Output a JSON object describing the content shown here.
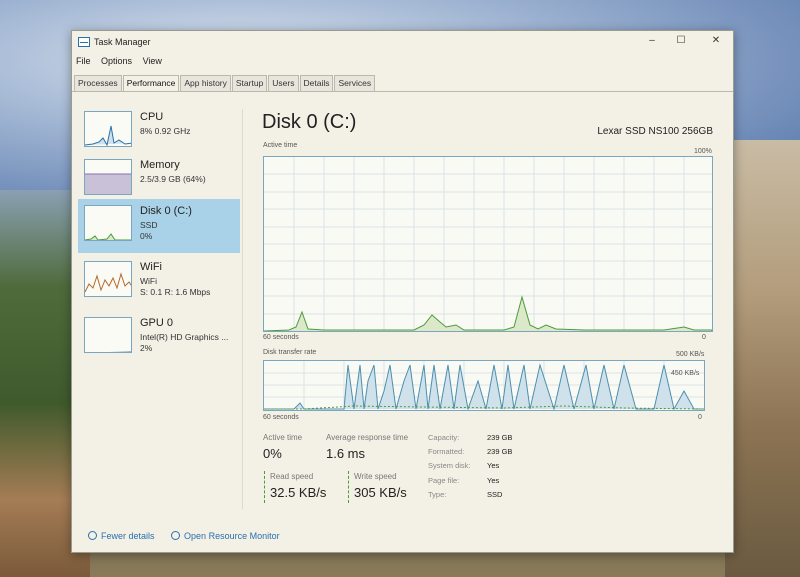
{
  "window": {
    "title": "Task Manager",
    "minimize": "–",
    "maximize": "☐",
    "close": "✕"
  },
  "menu": [
    "File",
    "Options",
    "View"
  ],
  "tabs": [
    {
      "label": "Processes",
      "active": false
    },
    {
      "label": "Performance",
      "active": true
    },
    {
      "label": "App history",
      "active": false
    },
    {
      "label": "Startup",
      "active": false
    },
    {
      "label": "Users",
      "active": false
    },
    {
      "label": "Details",
      "active": false
    },
    {
      "label": "Services",
      "active": false
    }
  ],
  "sidebar": [
    {
      "name": "CPU",
      "sub1": "8% 0.92 GHz",
      "sub2": "",
      "sub3": "",
      "active": false
    },
    {
      "name": "Memory",
      "sub1": "2.5/3.9 GB (64%)",
      "sub2": "",
      "sub3": "",
      "active": false
    },
    {
      "name": "Disk 0 (C:)",
      "sub1": "SSD",
      "sub2": "0%",
      "sub3": "",
      "active": true
    },
    {
      "name": "WiFi",
      "sub1": "WiFi",
      "sub2": "S: 0.1 R: 1.6 Mbps",
      "sub3": "",
      "active": false
    },
    {
      "name": "GPU 0",
      "sub1": "Intel(R) HD Graphics ...",
      "sub2": "2%",
      "sub3": "",
      "active": false
    }
  ],
  "main": {
    "title": "Disk 0 (C:)",
    "device": "Lexar SSD NS100 256GB",
    "active_graph": {
      "label": "Active time",
      "max": "100%",
      "time": "60 seconds",
      "min": "0"
    },
    "transfer_graph": {
      "label": "Disk transfer rate",
      "max": "500 KB/s",
      "mid": "450 KB/s",
      "time": "60 seconds",
      "min": "0"
    },
    "stats": {
      "active_time_label": "Active time",
      "active_time": "0%",
      "avg_resp_label": "Average response time",
      "avg_resp": "1.6 ms",
      "read_label": "Read speed",
      "read": "32.5 KB/s",
      "write_label": "Write speed",
      "write": "305 KB/s"
    },
    "properties": [
      {
        "label": "Capacity:",
        "value": "239 GB"
      },
      {
        "label": "Formatted:",
        "value": "239 GB"
      },
      {
        "label": "System disk:",
        "value": "Yes"
      },
      {
        "label": "Page file:",
        "value": "Yes"
      },
      {
        "label": "Type:",
        "value": "SSD"
      }
    ]
  },
  "footer": {
    "fewer_details": "Fewer details",
    "resource_monitor": "Open Resource Monitor"
  },
  "colors": {
    "accent": "#2a6fb0",
    "graph_line": "#6c9fb8",
    "selected": "#a9d1e8",
    "graph_fill": "#cfe1ea"
  }
}
